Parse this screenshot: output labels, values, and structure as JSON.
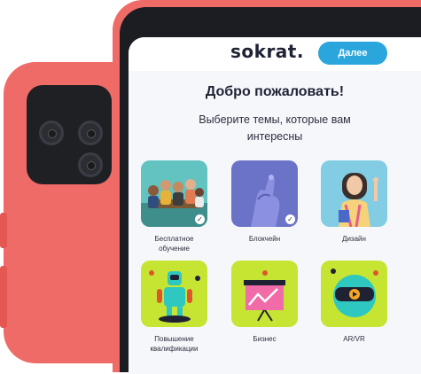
{
  "brand": {
    "logo": "sokrat.",
    "accent": "#2aa6dc",
    "phone_color": "#ef6b67"
  },
  "header": {
    "next_label": "Далее"
  },
  "welcome": {
    "title": "Добро пожаловать!",
    "subtitle": "Выберите темы, которые вам интересны"
  },
  "topics": [
    {
      "label": "Бесплатное обучение",
      "selected": true,
      "icon": "group-photo"
    },
    {
      "label": "Блокчейн",
      "selected": true,
      "icon": "hand-photo"
    },
    {
      "label": "Дизайн",
      "selected": false,
      "icon": "designer-photo"
    },
    {
      "label": "Повышение квалификации",
      "selected": false,
      "icon": "robot-icon"
    },
    {
      "label": "Бизнес",
      "selected": false,
      "icon": "presentation-chart-icon"
    },
    {
      "label": "AR/VR",
      "selected": false,
      "icon": "vr-headset-icon"
    }
  ],
  "check_glyph": "✓"
}
